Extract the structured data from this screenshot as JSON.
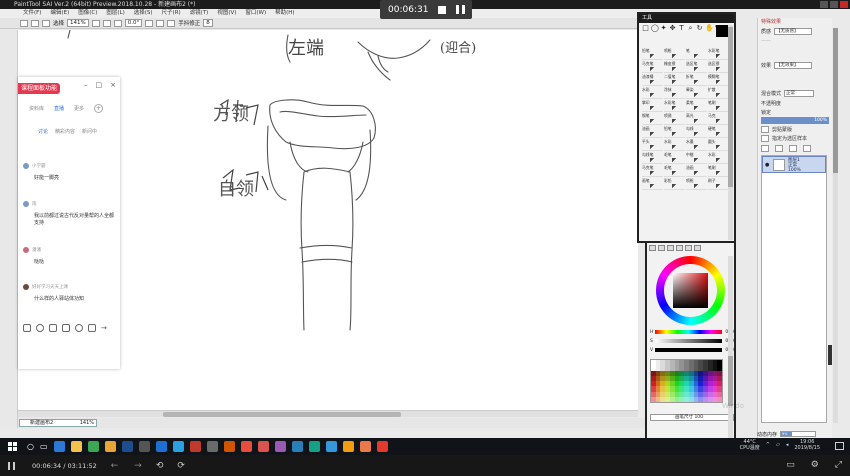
{
  "app": {
    "title": "PaintTool SAI Ver.2 (64bit) Preview.2018.10.28 - 新建画布2 (*)",
    "menu": [
      "文件(F)",
      "编辑(E)",
      "图像(C)",
      "图层(L)",
      "选择(S)",
      "尺子(R)",
      "滤镜(T)",
      "视图(V)",
      "窗口(W)",
      "帮助(H)"
    ],
    "toolbar": {
      "select_label": "选择",
      "zoom": "141%",
      "rotation": "0.0°",
      "stabilizer_label": "手抖修正",
      "stabilizer_value": "8"
    },
    "canvas_tab": {
      "name": "新建画布2",
      "zoom": "141%"
    }
  },
  "recording": {
    "time": "00:06:31"
  },
  "chat": {
    "title": "课程面板功能",
    "tabs": [
      "资料库",
      "直播",
      "更多"
    ],
    "active_tab": "直播",
    "subtabs": [
      "讨论",
      "精彩内容",
      "新问中"
    ],
    "messages": [
      {
        "user": "小学霸",
        "text": "好能一脚亮"
      },
      {
        "user": "雨",
        "text": "我以前都过说古代反对量帮的人全都支持"
      },
      {
        "user": "潘潘",
        "text": "哒哒"
      },
      {
        "user": "好好学习天天上课",
        "text": "什么样的人驿站体功知"
      }
    ]
  },
  "tool_panel": {
    "title": "工具",
    "tools": [
      "铅笔",
      "喷枪",
      "笔",
      "水彩笔",
      "马克笔",
      "橡皮擦",
      "选区笔",
      "选区擦",
      "油漆桶",
      "二值笔",
      "折笔",
      "模糊笔",
      "水彩",
      "涂抹",
      "晕染",
      "扩散",
      "掌印",
      "水彩笔",
      "柔笔",
      "笔刷",
      "钢笔",
      "喷溅",
      "高光",
      "马克",
      "油画",
      "铅笔",
      "勾线",
      "硬笔",
      "平头",
      "水彩",
      "水墨",
      "圆头",
      "勾线笔",
      "毛笔",
      "中楷",
      "水彩",
      "马克笔",
      "毛笔",
      "油画",
      "笔刷",
      "画笔",
      "彩铅",
      "喷枪",
      "刷子"
    ]
  },
  "color_panel": {
    "h_value": "000",
    "s_value": "000",
    "v_value": "000",
    "bottom_label": "画笔尺寸",
    "bottom_value": "100"
  },
  "layer_panel": {
    "section_title": "特殊效果",
    "texture_label": "质感",
    "texture_value": "【无质感】",
    "effect_label": "效果",
    "effect_value": "【无效果】",
    "blend_label": "混合模式",
    "blend_value": "正常",
    "opacity_label": "不透明度",
    "opacity_value": "100%",
    "lock_label": "锁定",
    "clip_label": "剪贴蒙版",
    "select_src_label": "指定为选区样本",
    "layer_name": "图层1",
    "layer_mode": "正常",
    "layer_opacity": "100%"
  },
  "memory": {
    "label": "动态内存",
    "value": "9%"
  },
  "taskbar": {
    "temp": "44°C",
    "cpu_label": "CPU温度",
    "time": "19:06",
    "date": "2019/8/15"
  },
  "player": {
    "elapsed": "00:06:34",
    "total": "03:11:52"
  },
  "watermark": "Windo",
  "sketch": {
    "labels": [
      "左端",
      "(迎合)",
      "方领",
      "自领"
    ]
  }
}
